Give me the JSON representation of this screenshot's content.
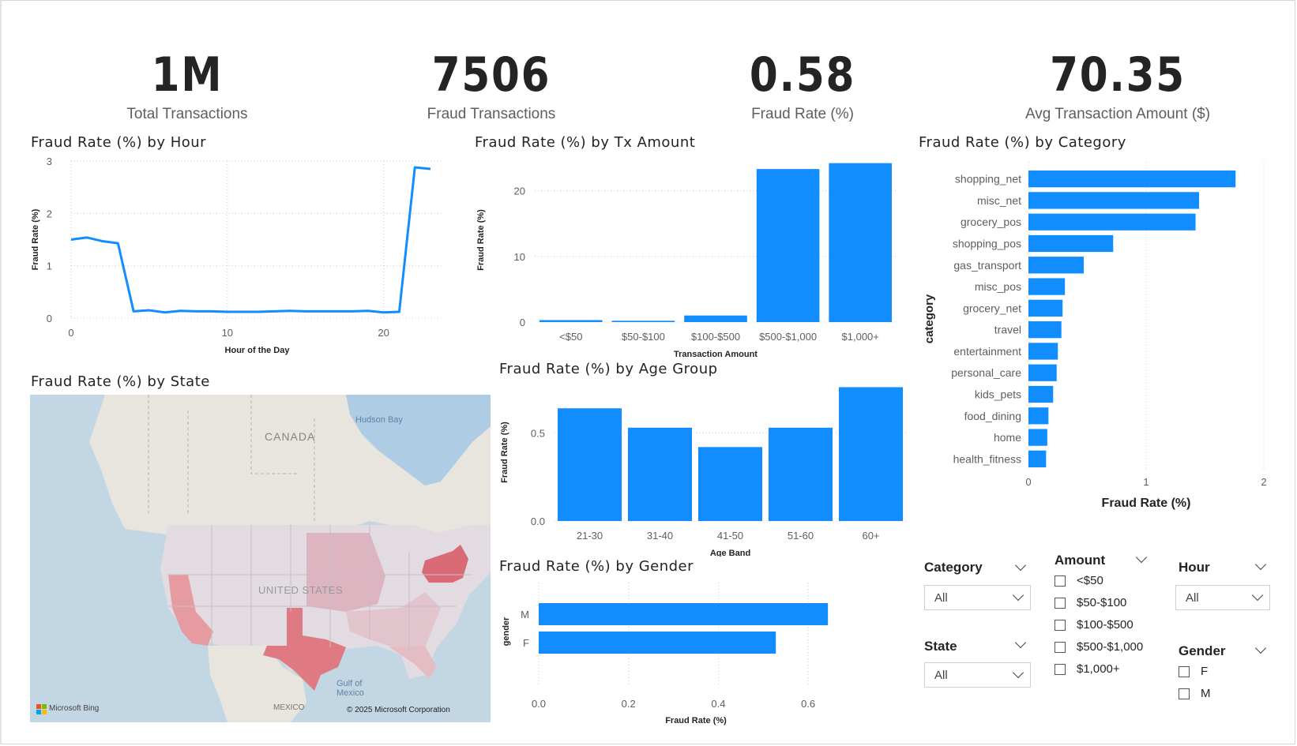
{
  "kpis": [
    {
      "value": "1M",
      "label": "Total Transactions"
    },
    {
      "value": "7506",
      "label": "Fraud Transactions"
    },
    {
      "value": "0.58",
      "label": "Fraud Rate (%)"
    },
    {
      "value": "70.35",
      "label": "Avg Transaction Amount ($)"
    }
  ],
  "colors": {
    "bar": "#118DFF",
    "grid": "#c8c8c8",
    "text": "#252423",
    "axis_text": "#605e5c"
  },
  "chart_data": [
    {
      "id": "hour",
      "type": "line",
      "title": "Fraud Rate (%) by Hour",
      "xlabel": "Hour of the Day",
      "ylabel": "Fraud Rate (%)",
      "x": [
        0,
        1,
        2,
        3,
        4,
        5,
        6,
        7,
        8,
        9,
        10,
        11,
        12,
        13,
        14,
        15,
        16,
        17,
        18,
        19,
        20,
        21,
        22,
        23
      ],
      "values": [
        1.5,
        1.54,
        1.47,
        1.43,
        0.13,
        0.15,
        0.11,
        0.14,
        0.13,
        0.13,
        0.12,
        0.12,
        0.12,
        0.13,
        0.14,
        0.13,
        0.13,
        0.13,
        0.13,
        0.14,
        0.11,
        0.12,
        2.88,
        2.85
      ],
      "xlim": [
        0,
        23
      ],
      "ylim": [
        0,
        3
      ],
      "xticks": [
        "0",
        "10",
        "20"
      ],
      "yticks": [
        "0",
        "1",
        "2",
        "3"
      ],
      "grid": true
    },
    {
      "id": "amount",
      "type": "bar",
      "title": "Fraud Rate (%) by Tx Amount",
      "xlabel": "Transaction Amount",
      "ylabel": "Fraud Rate (%)",
      "categories": [
        "<$50",
        "$50-$100",
        "$100-$500",
        "$500-$1,000",
        "$1,000+"
      ],
      "values": [
        0.3,
        0.2,
        1.0,
        23.3,
        24.2
      ],
      "ylim": [
        0,
        25
      ],
      "yticks": [
        "0",
        "10",
        "20"
      ],
      "grid": true
    },
    {
      "id": "category",
      "type": "bar",
      "orientation": "horizontal",
      "title": "Fraud Rate (%) by Category",
      "xlabel": "Fraud Rate (%)",
      "ylabel": "category",
      "categories": [
        "shopping_net",
        "misc_net",
        "grocery_pos",
        "shopping_pos",
        "gas_transport",
        "misc_pos",
        "grocery_net",
        "travel",
        "entertainment",
        "personal_care",
        "kids_pets",
        "food_dining",
        "home",
        "health_fitness"
      ],
      "values": [
        1.76,
        1.45,
        1.42,
        0.72,
        0.47,
        0.31,
        0.29,
        0.28,
        0.25,
        0.24,
        0.21,
        0.17,
        0.16,
        0.15
      ],
      "xlim": [
        0,
        2
      ],
      "xticks": [
        "0",
        "1",
        "2"
      ],
      "grid": true
    },
    {
      "id": "age",
      "type": "bar",
      "title": "Fraud Rate (%) by Age Group",
      "xlabel": "Age Band",
      "ylabel": "Fraud Rate (%)",
      "categories": [
        "21-30",
        "31-40",
        "41-50",
        "51-60",
        "60+"
      ],
      "values": [
        0.64,
        0.53,
        0.42,
        0.53,
        0.76
      ],
      "ylim": [
        0,
        0.78
      ],
      "yticks": [
        "0.0",
        "0.5"
      ],
      "grid": true
    },
    {
      "id": "gender",
      "type": "bar",
      "orientation": "horizontal",
      "title": "Fraud Rate (%) by Gender",
      "xlabel": "Fraud Rate (%)",
      "ylabel": "gender",
      "categories": [
        "M",
        "F"
      ],
      "values": [
        0.644,
        0.528
      ],
      "xlim": [
        0,
        0.7
      ],
      "xticks": [
        "0.0",
        "0.2",
        "0.4",
        "0.6"
      ],
      "grid": true
    }
  ],
  "map": {
    "title": "Fraud Rate (%) by State",
    "labels": {
      "canada": "CANADA",
      "hudson_bay": "Hudson Bay",
      "united_states": "UNITED STATES",
      "gulf": "Gulf of Mexico",
      "mexico": "MEXICO"
    },
    "logo": "Microsoft Bing",
    "copyright": "© 2025 Microsoft Corporation"
  },
  "slicers": {
    "category": {
      "title": "Category",
      "selected": "All"
    },
    "state": {
      "title": "State",
      "selected": "All"
    },
    "hour": {
      "title": "Hour",
      "selected": "All"
    },
    "amount": {
      "title": "Amount",
      "options": [
        "<$50",
        "$50-$100",
        "$100-$500",
        "$500-$1,000",
        "$1,000+"
      ]
    },
    "gender": {
      "title": "Gender",
      "options": [
        "F",
        "M"
      ]
    }
  }
}
